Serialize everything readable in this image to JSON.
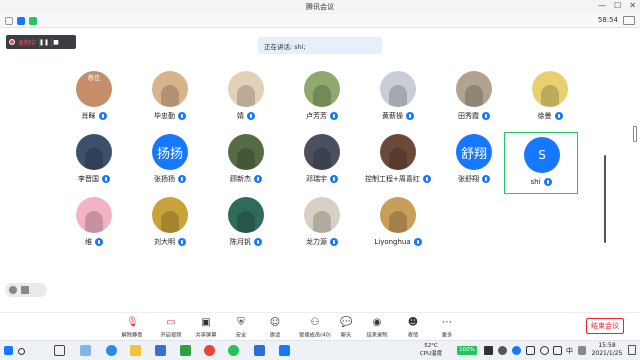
{
  "window": {
    "title": "腾讯会议",
    "top_time": "58:54"
  },
  "recording": {
    "label": "录制中"
  },
  "speaking": {
    "text": "正在讲话: shi;"
  },
  "participants": [
    {
      "name": "肖眯",
      "avatar_type": "photo",
      "avatar_text": "憨佳",
      "color": "#c58d6a"
    },
    {
      "name": "毕忠勤",
      "avatar_type": "photo",
      "color": "#d9b38c"
    },
    {
      "name": "婧",
      "avatar_type": "photo",
      "color": "#e3d0b8"
    },
    {
      "name": "卢芳芳",
      "avatar_type": "photo",
      "color": "#8fa86c"
    },
    {
      "name": "黄薪操",
      "avatar_type": "photo",
      "color": "#c9cdd6"
    },
    {
      "name": "田秀霞",
      "avatar_type": "photo",
      "color": "#b1a38f"
    },
    {
      "name": "徐曼",
      "avatar_type": "photo",
      "color": "#e8d070"
    },
    {
      "name": "李晋国",
      "avatar_type": "photo",
      "color": "#3c4f6b"
    },
    {
      "name": "张扬扬",
      "avatar_type": "text",
      "avatar_text": "扬扬",
      "color": "#1677ff"
    },
    {
      "name": "顾新杰",
      "avatar_type": "photo",
      "color": "#556b45"
    },
    {
      "name": "邓瑞宇",
      "avatar_type": "photo",
      "color": "#4a5060"
    },
    {
      "name": "控制工程+周喜红",
      "avatar_type": "photo",
      "color": "#6b4a3a"
    },
    {
      "name": "张舒翔",
      "avatar_type": "text",
      "avatar_text": "舒翔",
      "color": "#1677ff"
    },
    {
      "name": "shi",
      "avatar_type": "letter",
      "avatar_text": "S",
      "color": "#1677ff"
    },
    {
      "name": "维",
      "avatar_type": "photo",
      "color": "#f3b3c4"
    },
    {
      "name": "刘大明",
      "avatar_type": "photo",
      "color": "#c9a23a"
    },
    {
      "name": "陈月钒",
      "avatar_type": "photo",
      "color": "#2f6a5a"
    },
    {
      "name": "龙力源",
      "avatar_type": "photo",
      "color": "#d8d0c4"
    },
    {
      "name": "Liyonghua",
      "avatar_type": "photo",
      "color": "#c99d5a"
    }
  ],
  "toolbar": {
    "items": [
      {
        "label": "解除静音",
        "icon": "mic-muted-icon"
      },
      {
        "label": "开启视频",
        "icon": "video-off-icon"
      },
      {
        "label": "共享屏幕",
        "icon": "share-screen-icon"
      },
      {
        "label": "安全",
        "icon": "shield-icon"
      },
      {
        "label": "邀请",
        "icon": "invite-icon"
      },
      {
        "label": "管理成员(40)",
        "icon": "members-icon"
      },
      {
        "label": "聊天",
        "icon": "chat-icon"
      },
      {
        "label": "结束录制",
        "icon": "stop-record-icon"
      },
      {
        "label": "表情",
        "icon": "emoji-icon"
      },
      {
        "label": "更多",
        "icon": "more-icon"
      }
    ],
    "end_label": "结束会议"
  },
  "taskbar": {
    "weather_temp": "52°C",
    "weather_label": "CPU温度",
    "battery": "100%",
    "lang": "中",
    "time": "15:58",
    "date": "2021/1/25"
  }
}
